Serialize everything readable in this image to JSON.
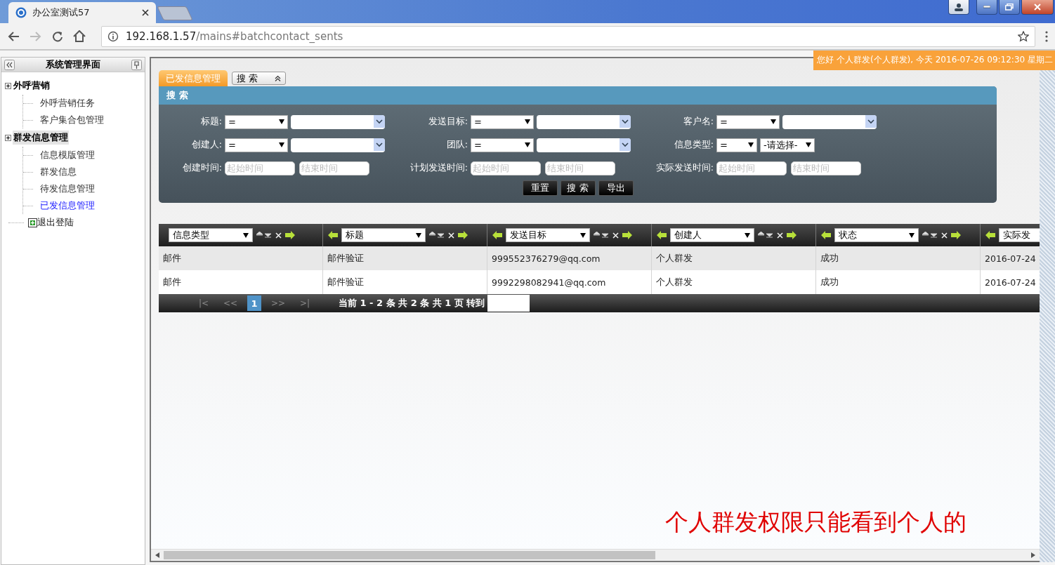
{
  "browser": {
    "tab_title": "办公室测试57",
    "url_host": "192.168.1.57",
    "url_path": "/mains#batchcontact_sents",
    "forward_disabled": true
  },
  "sidebar": {
    "title": "系统管理界面",
    "groups": [
      {
        "label": "外呼营销",
        "selected": false,
        "children": [
          {
            "label": "外呼营销任务",
            "selected": false
          },
          {
            "label": "客户集合包管理",
            "selected": false
          }
        ]
      },
      {
        "label": "群发信息管理",
        "selected": true,
        "children": [
          {
            "label": "信息模版管理",
            "selected": false
          },
          {
            "label": "群发信息",
            "selected": false
          },
          {
            "label": "待发信息管理",
            "selected": false
          },
          {
            "label": "已发信息管理",
            "selected": true
          }
        ]
      }
    ],
    "logout": "退出登陆"
  },
  "greeting": "您好 个人群发(个人群发), 今天 2016-07-26 09:12:30 星期二",
  "tabs": [
    {
      "label": "已发信息管理",
      "selected": true
    }
  ],
  "search_toggle": {
    "label": "搜 索",
    "expanded": true
  },
  "search_panel": {
    "title": "搜 索",
    "rows": [
      [
        {
          "label": "标题:",
          "kind": "combo",
          "operator": "="
        },
        {
          "label": "发送目标:",
          "kind": "combo",
          "operator": "="
        },
        {
          "label": "客户名:",
          "kind": "combo",
          "operator": "="
        }
      ],
      [
        {
          "label": "创建人:",
          "kind": "combo",
          "operator": "="
        },
        {
          "label": "团队:",
          "kind": "combo",
          "operator": "="
        },
        {
          "label": "信息类型:",
          "kind": "select",
          "operator": "=",
          "value": "-请选择-"
        }
      ],
      [
        {
          "label": "创建时间:",
          "kind": "daterange",
          "placeholders": [
            "起始时间",
            "结束时间"
          ]
        },
        {
          "label": "计划发送时间:",
          "kind": "daterange",
          "placeholders": [
            "起始时间",
            "结束时间"
          ]
        },
        {
          "label": "实际发送时间:",
          "kind": "daterange",
          "placeholders": [
            "起始时间",
            "结束时间"
          ]
        }
      ]
    ],
    "buttons": [
      "重置",
      "搜 索",
      "导出"
    ]
  },
  "table": {
    "columns": [
      "信息类型",
      "标题",
      "发送目标",
      "创建人",
      "状态",
      "实际发"
    ],
    "rows": [
      [
        "邮件",
        "邮件验证",
        "999552376279@qq.com",
        "个人群发",
        "成功",
        "2016-07-24"
      ],
      [
        "邮件",
        "邮件验证",
        "9992298082941@qq.com",
        "个人群发",
        "成功",
        "2016-07-24"
      ]
    ]
  },
  "pagination": {
    "first": "|<",
    "prev": "<<",
    "pages": [
      {
        "label": "1",
        "selected": true
      }
    ],
    "next": ">>",
    "last": ">|",
    "summary": "当前 1 - 2 条 共 2 条 共 1 页 转到"
  },
  "annotation": "个人群发权限只能看到个人的"
}
